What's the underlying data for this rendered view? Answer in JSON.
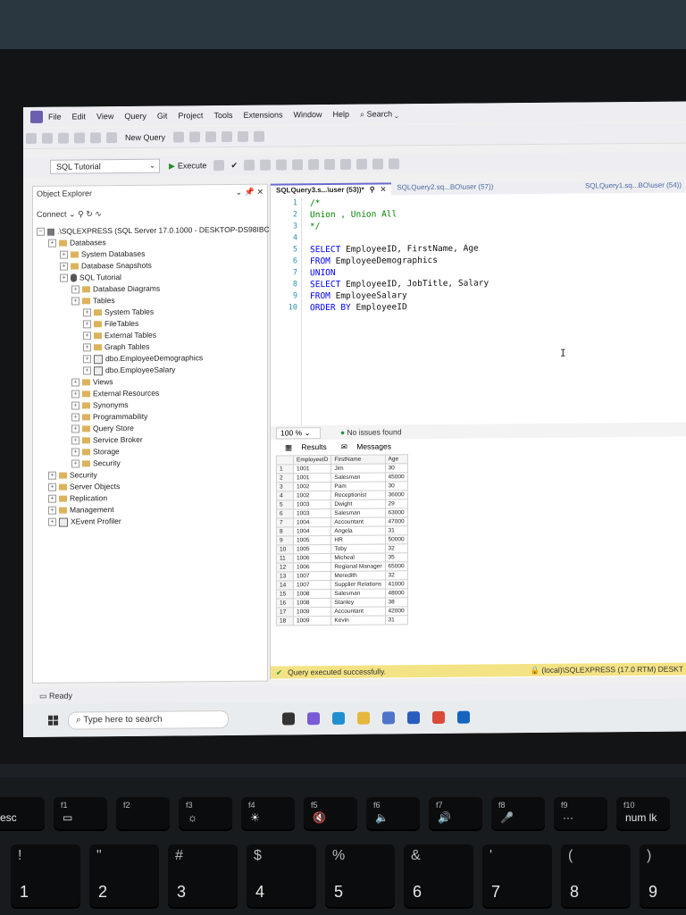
{
  "menubar": {
    "items": [
      "File",
      "Edit",
      "View",
      "Query",
      "Git",
      "Project",
      "Tools",
      "Extensions",
      "Window",
      "Help"
    ],
    "search": "Search"
  },
  "toolbar": {
    "new_query": "New Query",
    "database": "SQL Tutorial",
    "execute": "Execute"
  },
  "object_explorer": {
    "title": "Object Explorer",
    "connect": "Connect",
    "server": ".\\SQLEXPRESS (SQL Server 17.0.1000 - DESKTOP-DS98IBC",
    "nodes": [
      {
        "label": "Databases",
        "level": 1,
        "icon": "folder"
      },
      {
        "label": "System Databases",
        "level": 2,
        "icon": "folder"
      },
      {
        "label": "Database Snapshots",
        "level": 2,
        "icon": "folder"
      },
      {
        "label": "SQL Tutorial",
        "level": 2,
        "icon": "database"
      },
      {
        "label": "Database Diagrams",
        "level": 3,
        "icon": "folder"
      },
      {
        "label": "Tables",
        "level": 3,
        "icon": "folder"
      },
      {
        "label": "System Tables",
        "level": 4,
        "icon": "folder"
      },
      {
        "label": "FileTables",
        "level": 4,
        "icon": "folder"
      },
      {
        "label": "External Tables",
        "level": 4,
        "icon": "folder"
      },
      {
        "label": "Graph Tables",
        "level": 4,
        "icon": "folder"
      },
      {
        "label": "dbo.EmployeeDemographics",
        "level": 4,
        "icon": "table"
      },
      {
        "label": "dbo.EmployeeSalary",
        "level": 4,
        "icon": "table"
      },
      {
        "label": "Views",
        "level": 3,
        "icon": "folder"
      },
      {
        "label": "External Resources",
        "level": 3,
        "icon": "folder"
      },
      {
        "label": "Synonyms",
        "level": 3,
        "icon": "folder"
      },
      {
        "label": "Programmability",
        "level": 3,
        "icon": "folder"
      },
      {
        "label": "Query Store",
        "level": 3,
        "icon": "folder"
      },
      {
        "label": "Service Broker",
        "level": 3,
        "icon": "folder"
      },
      {
        "label": "Storage",
        "level": 3,
        "icon": "folder"
      },
      {
        "label": "Security",
        "level": 3,
        "icon": "folder"
      },
      {
        "label": "Security",
        "level": 1,
        "icon": "folder"
      },
      {
        "label": "Server Objects",
        "level": 1,
        "icon": "folder"
      },
      {
        "label": "Replication",
        "level": 1,
        "icon": "folder"
      },
      {
        "label": "Management",
        "level": 1,
        "icon": "folder"
      },
      {
        "label": "XEvent Profiler",
        "level": 1,
        "icon": "profiler"
      }
    ]
  },
  "tabs": [
    {
      "label": "SQLQuery3.s...\\user (53))*",
      "active": true
    },
    {
      "label": "SQLQuery2.sq...BO\\user (57))",
      "active": false
    },
    {
      "label": "SQLQuery1.sq...BO\\user (54))",
      "active": false
    }
  ],
  "editor": {
    "lines": [
      [
        {
          "t": "/*",
          "c": "cm"
        }
      ],
      [
        {
          "t": "Union , Union All",
          "c": "cm"
        }
      ],
      [
        {
          "t": "*/",
          "c": "cm"
        }
      ],
      [],
      [
        {
          "t": "SELECT",
          "c": "kw"
        },
        {
          "t": " EmployeeID, FirstName, Age",
          "c": "tx"
        }
      ],
      [
        {
          "t": "FROM",
          "c": "kw"
        },
        {
          "t": " EmployeeDemographics",
          "c": "tx"
        }
      ],
      [
        {
          "t": "UNION",
          "c": "kw"
        }
      ],
      [
        {
          "t": "SELECT",
          "c": "kw"
        },
        {
          "t": " EmployeeID, JobTitle, Salary",
          "c": "tx"
        }
      ],
      [
        {
          "t": "FROM",
          "c": "kw"
        },
        {
          "t": " EmployeeSalary",
          "c": "tx"
        }
      ],
      [
        {
          "t": "ORDER BY",
          "c": "kw"
        },
        {
          "t": " EmployeeID",
          "c": "tx"
        }
      ]
    ]
  },
  "zoom": "100 %",
  "issues": "No issues found",
  "results_tabs": {
    "results": "Results",
    "messages": "Messages"
  },
  "results": {
    "columns": [
      "EmployeeID",
      "FirstName",
      "Age"
    ],
    "rows": [
      [
        "1001",
        "Jim",
        "30"
      ],
      [
        "1001",
        "Salesman",
        "45000"
      ],
      [
        "1002",
        "Pam",
        "30"
      ],
      [
        "1002",
        "Receptionist",
        "36000"
      ],
      [
        "1003",
        "Dwight",
        "29"
      ],
      [
        "1003",
        "Salesman",
        "63000"
      ],
      [
        "1004",
        "Accountant",
        "47000"
      ],
      [
        "1004",
        "Angela",
        "31"
      ],
      [
        "1005",
        "HR",
        "50000"
      ],
      [
        "1005",
        "Toby",
        "32"
      ],
      [
        "1006",
        "Micheal",
        "35"
      ],
      [
        "1006",
        "Regional Manager",
        "65000"
      ],
      [
        "1007",
        "Meredith",
        "32"
      ],
      [
        "1007",
        "Supplier Relations",
        "41000"
      ],
      [
        "1008",
        "Salesman",
        "48000"
      ],
      [
        "1008",
        "Stanley",
        "38"
      ],
      [
        "1009",
        "Accountant",
        "42000"
      ],
      [
        "1009",
        "Kevin",
        "31"
      ]
    ]
  },
  "status": {
    "message": "Query executed successfully.",
    "server": "(local)\\SQLEXPRESS (17.0 RTM)",
    "desktop": "DESKT"
  },
  "ready": "Ready",
  "taskbar": {
    "search_placeholder": "Type here to search"
  },
  "keyboard": {
    "fkeys": [
      {
        "top": "",
        "label": "esc"
      },
      {
        "top": "f1",
        "label": "▭"
      },
      {
        "top": "f2",
        "label": ""
      },
      {
        "top": "f3",
        "label": "☼"
      },
      {
        "top": "f4",
        "label": "☀"
      },
      {
        "top": "f5",
        "label": "🔇"
      },
      {
        "top": "f6",
        "label": "🔈"
      },
      {
        "top": "f7",
        "label": "🔊"
      },
      {
        "top": "f8",
        "label": "🎤"
      },
      {
        "top": "f9",
        "label": "···"
      },
      {
        "top": "f10",
        "label": "num lk"
      }
    ],
    "numkeys": [
      {
        "top": "!",
        "label": "1"
      },
      {
        "top": "\"",
        "label": "2"
      },
      {
        "top": "#",
        "label": "3"
      },
      {
        "top": "$",
        "label": "4"
      },
      {
        "top": "%",
        "label": "5"
      },
      {
        "top": "&",
        "label": "6"
      },
      {
        "top": "'",
        "label": "7"
      },
      {
        "top": "(",
        "label": "8"
      },
      {
        "top": ")",
        "label": "9"
      }
    ]
  }
}
